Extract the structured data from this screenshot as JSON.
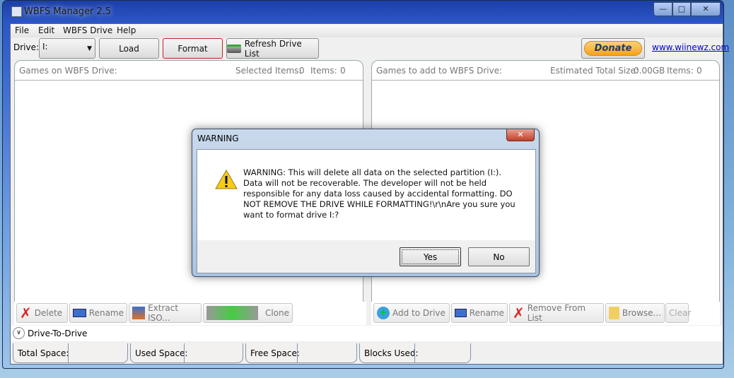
{
  "window": {
    "title": "WBFS Manager 2.5"
  },
  "menu": [
    "File",
    "Edit",
    "WBFS Drive",
    "Help"
  ],
  "toolbar": {
    "drive_label": "Drive:",
    "drive_value": "I:",
    "load": "Load",
    "format": "Format",
    "refresh": "Refresh Drive List",
    "donate": "Donate",
    "link": "www.wiinewz.com"
  },
  "left_panel": {
    "title": "Games on WBFS Drive:",
    "selected_label": "Selected Items:",
    "selected": "0",
    "items_label": "Items:",
    "items": "0"
  },
  "right_panel": {
    "title": "Games to add to WBFS Drive:",
    "size_label": "Estimated Total Size:",
    "size": "0.00GB",
    "items_label": "Items:",
    "items": "0"
  },
  "left_tools": [
    "Delete",
    "Rename",
    "Extract ISO...",
    "Clone"
  ],
  "right_tools": [
    "Add to Drive",
    "Rename",
    "Remove From List",
    "Browse...",
    "Clear"
  ],
  "drive_to_drive": "Drive-To-Drive",
  "status": [
    "Total Space:",
    "Used Space:",
    "Free Space:",
    "Blocks Used:"
  ],
  "dialog": {
    "title": "WARNING",
    "message": "WARNING: This will delete all data on the selected partition (I:). Data will not be recoverable. The developer will not be held responsible for any data loss caused by accidental formatting. DO NOT REMOVE THE DRIVE WHILE FORMATTING!\\r\\nAre you sure you want to format drive I:?",
    "yes": "Yes",
    "no": "No"
  },
  "colors": {
    "format_border": "#c42020",
    "link": "#0000cc",
    "donate": "#f7a21c"
  }
}
